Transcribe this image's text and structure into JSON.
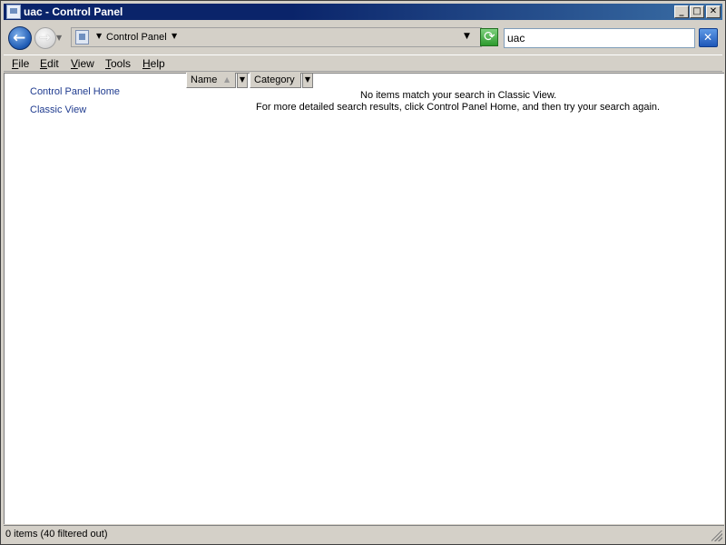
{
  "window": {
    "title": "uac - Control Panel",
    "minimize_label": "_",
    "maximize_label": "□",
    "close_label": "✕"
  },
  "navigation": {
    "back_icon": "back-arrow-icon",
    "forward_icon": "forward-arrow-icon",
    "address_breadcrumb": "Control Panel",
    "search_value": "uac",
    "refresh_icon": "refresh-icon",
    "clear_search_icon": "close-icon"
  },
  "menu": {
    "items": [
      {
        "key": "F",
        "rest": "ile"
      },
      {
        "key": "E",
        "rest": "dit"
      },
      {
        "key": "V",
        "rest": "iew"
      },
      {
        "key": "T",
        "rest": "ools"
      },
      {
        "key": "H",
        "rest": "elp"
      }
    ]
  },
  "sidebar": {
    "links": [
      "Control Panel Home",
      "Classic View"
    ]
  },
  "columns": [
    "Name",
    "Category"
  ],
  "results": {
    "line1": "No items match your search in Classic View.",
    "line2": "For more detailed search results, click Control Panel Home, and then try your search again."
  },
  "status": {
    "text": "0 items (40 filtered out)"
  },
  "colors": {
    "titlebar": "#0a246a",
    "link": "#1f3b8f",
    "chrome": "#d4d0c8"
  }
}
